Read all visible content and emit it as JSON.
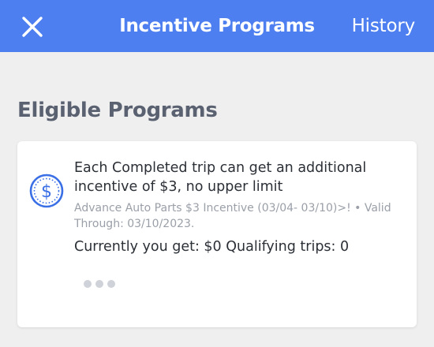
{
  "header": {
    "title": "Incentive Programs",
    "history_label": "History",
    "close_icon": "close-icon",
    "background_color": "#4d7ff0"
  },
  "section": {
    "title": "Eligible Programs"
  },
  "program": {
    "icon": "dollar-coin-icon",
    "icon_color": "#3a6fe6",
    "description": "Each Completed trip can get an additional incentive of $3, no upper limit",
    "subtitle": "Advance Auto Parts $3 Incentive (03/04- 03/10)>! • Valid Through: 03/10/2023.",
    "current_status": "Currently you get: $0 Qualifying trips: 0"
  },
  "pager": {
    "dot_count": 3
  }
}
